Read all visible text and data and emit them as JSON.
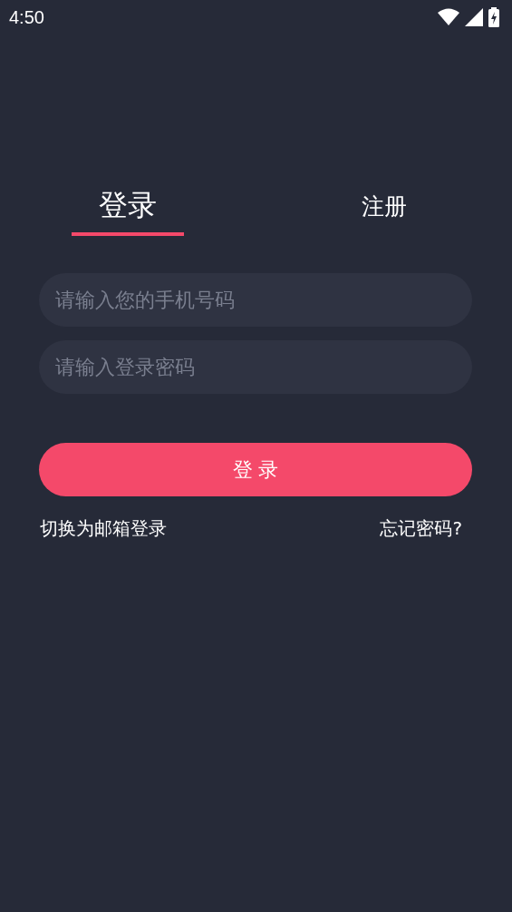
{
  "status_bar": {
    "time": "4:50"
  },
  "tabs": [
    {
      "label": "登录",
      "selected": true
    },
    {
      "label": "注册",
      "selected": false
    }
  ],
  "fields": [
    {
      "placeholder": "请输入您的手机号码"
    },
    {
      "placeholder": "请输入登录密码"
    }
  ],
  "login_button": "登 录",
  "links": [
    "切换为邮箱登录",
    "忘记密码?"
  ]
}
